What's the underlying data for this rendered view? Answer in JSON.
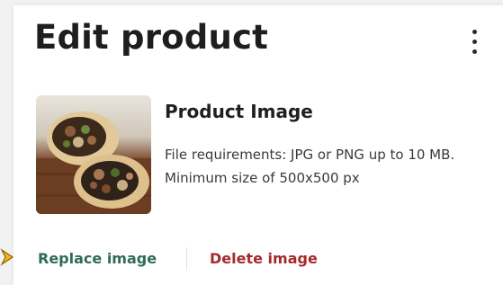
{
  "header": {
    "title": "Edit product",
    "menu_icon": "more-vertical-icon"
  },
  "product_image": {
    "heading": "Product Image",
    "description": "File requirements: JPG or PNG up to 10 MB. Minimum size of 500x500 px",
    "thumbnail_icon": "product-photo"
  },
  "actions": {
    "replace_label": "Replace image",
    "delete_label": "Delete image"
  },
  "colors": {
    "replace": "#2e6b58",
    "delete": "#a52a2a",
    "cursor": "#f3b51a"
  }
}
